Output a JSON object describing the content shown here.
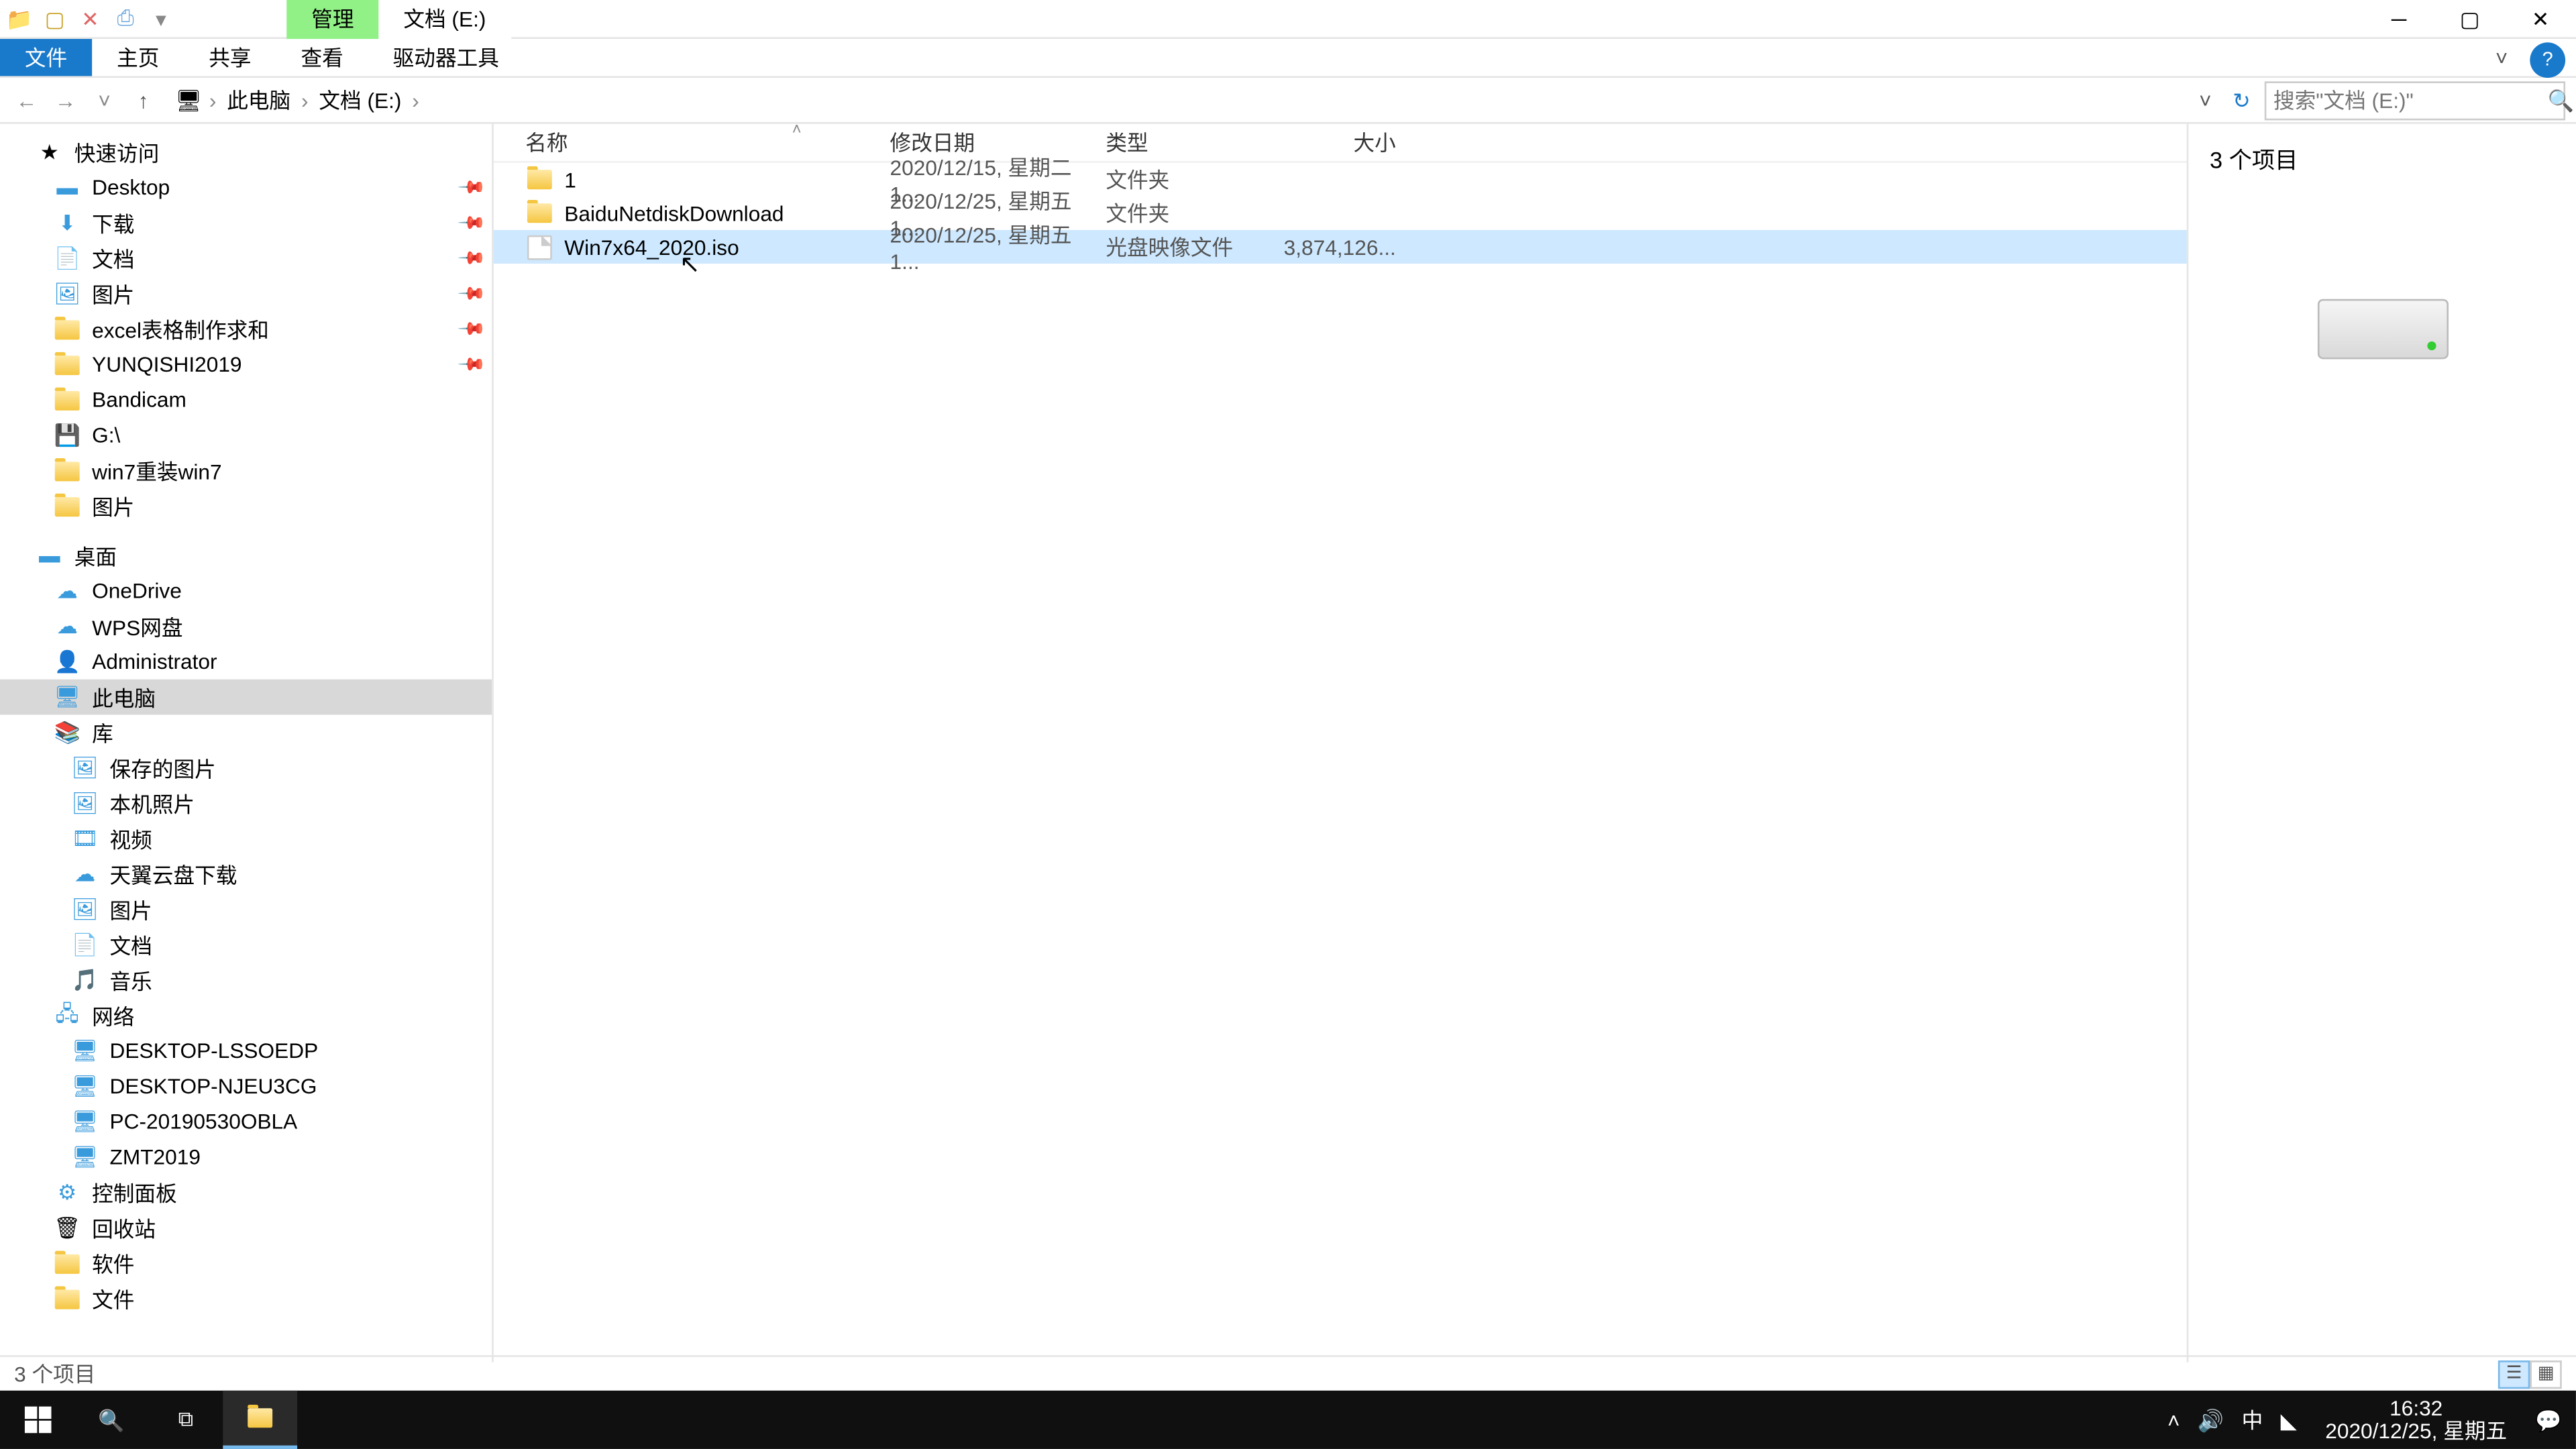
{
  "title": {
    "manage": "管理",
    "location": "文档 (E:)"
  },
  "ribbon": {
    "file": "文件",
    "home": "主页",
    "share": "共享",
    "view": "查看",
    "drive_tools": "驱动器工具"
  },
  "breadcrumb": {
    "root": "此电脑",
    "loc": "文档 (E:)"
  },
  "search": {
    "placeholder": "搜索\"文档 (E:)\""
  },
  "columns": {
    "name": "名称",
    "date": "修改日期",
    "type": "类型",
    "size": "大小"
  },
  "rows": [
    {
      "name": "1",
      "date": "2020/12/15, 星期二 1...",
      "type": "文件夹",
      "size": "",
      "icon": "folder"
    },
    {
      "name": "BaiduNetdiskDownload",
      "date": "2020/12/25, 星期五 1...",
      "type": "文件夹",
      "size": "",
      "icon": "folder"
    },
    {
      "name": "Win7x64_2020.iso",
      "date": "2020/12/25, 星期五 1...",
      "type": "光盘映像文件",
      "size": "3,874,126...",
      "icon": "file"
    }
  ],
  "nav": {
    "quick": "快速访问",
    "quick_items": [
      "Desktop",
      "下载",
      "文档",
      "图片",
      "excel表格制作求和",
      "YUNQISHI2019",
      "Bandicam",
      "G:\\",
      "win7重装win7",
      "图片"
    ],
    "desktop": "桌面",
    "desktop_items": [
      "OneDrive",
      "WPS网盘",
      "Administrator",
      "此电脑",
      "库"
    ],
    "lib_items": [
      "保存的图片",
      "本机照片",
      "视频",
      "天翼云盘下载",
      "图片",
      "文档",
      "音乐"
    ],
    "network": "网络",
    "net_items": [
      "DESKTOP-LSSOEDP",
      "DESKTOP-NJEU3CG",
      "PC-20190530OBLA",
      "ZMT2019"
    ],
    "control": "控制面板",
    "recycle": "回收站",
    "software": "软件",
    "docs": "文件"
  },
  "preview": {
    "count": "3 个项目"
  },
  "status": {
    "text": "3 个项目"
  },
  "tray": {
    "ime": "中",
    "time": "16:32",
    "date": "2020/12/25, 星期五"
  }
}
